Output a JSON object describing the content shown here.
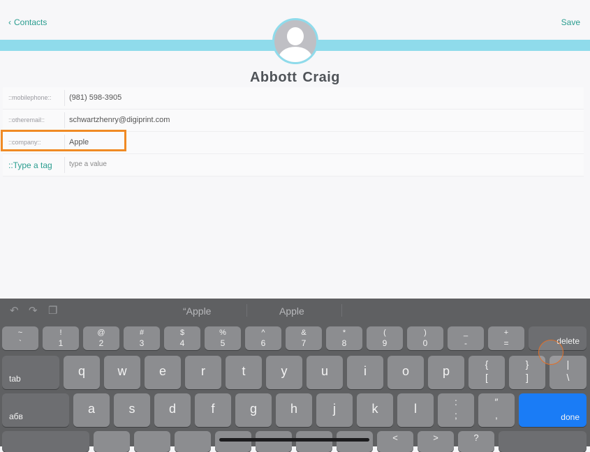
{
  "nav": {
    "back_label": "Contacts",
    "save_label": "Save"
  },
  "contact": {
    "first_name": "Abbott",
    "last_name": "Craig"
  },
  "fields": [
    {
      "label": "::mobilephone::",
      "value": "(981) 598-3905"
    },
    {
      "label": "::otheremail::",
      "value": "schwartzhenry@digiprint.com"
    },
    {
      "label": "::company::",
      "value": "Apple"
    }
  ],
  "new_field": {
    "label": "::Type a tag",
    "placeholder": "type a value"
  },
  "keyboard": {
    "suggestions": [
      "“Apple",
      "Apple"
    ],
    "number_row": [
      {
        "up": "~",
        "down": "`"
      },
      {
        "up": "!",
        "down": "1"
      },
      {
        "up": "@",
        "down": "2"
      },
      {
        "up": "#",
        "down": "3"
      },
      {
        "up": "$",
        "down": "4"
      },
      {
        "up": "%",
        "down": "5"
      },
      {
        "up": "^",
        "down": "6"
      },
      {
        "up": "&",
        "down": "7"
      },
      {
        "up": "*",
        "down": "8"
      },
      {
        "up": "(",
        "down": "9"
      },
      {
        "up": ")",
        "down": "0"
      },
      {
        "up": "_",
        "down": "-"
      },
      {
        "up": "+",
        "down": "="
      }
    ],
    "delete_label": "delete",
    "tab_label": "tab",
    "row2": [
      "q",
      "w",
      "e",
      "r",
      "t",
      "y",
      "u",
      "i",
      "o",
      "p"
    ],
    "row2_extra": [
      {
        "up": "{",
        "down": "["
      },
      {
        "up": "}",
        "down": "]"
      },
      {
        "up": "|",
        "down": "\\"
      }
    ],
    "lang_label": "абв",
    "row3": [
      "a",
      "s",
      "d",
      "f",
      "g",
      "h",
      "j",
      "k",
      "l"
    ],
    "row3_extra": [
      {
        "up": ":",
        "down": ";"
      },
      {
        "up": "″",
        "down": ","
      }
    ],
    "done_label": "done",
    "row4_partial": [
      {
        "up": "<"
      },
      {
        "up": ">"
      },
      {
        "up": "?"
      }
    ]
  },
  "colors": {
    "accent": "#2a9d8f",
    "band": "#8fdbeb",
    "highlight": "#f08a24",
    "done": "#1a7cf6"
  }
}
